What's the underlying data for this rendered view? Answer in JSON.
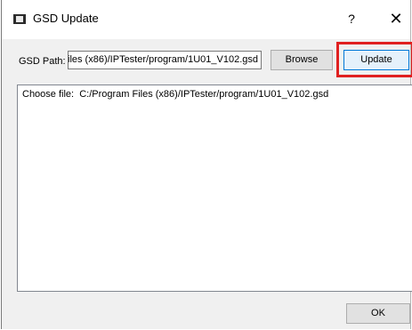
{
  "window": {
    "title": "GSD Update",
    "help_label": "?",
    "close_label": "✕"
  },
  "path": {
    "label": "GSD Path:",
    "value": "C:/Program Files (x86)/IPTester/program/1U01_V102.gsd"
  },
  "buttons": {
    "browse": "Browse",
    "update": "Update",
    "ok": "OK"
  },
  "log": {
    "text": "Choose file:  C:/Program Files (x86)/IPTester/program/1U01_V102.gsd"
  },
  "highlight_color": "#e02020"
}
